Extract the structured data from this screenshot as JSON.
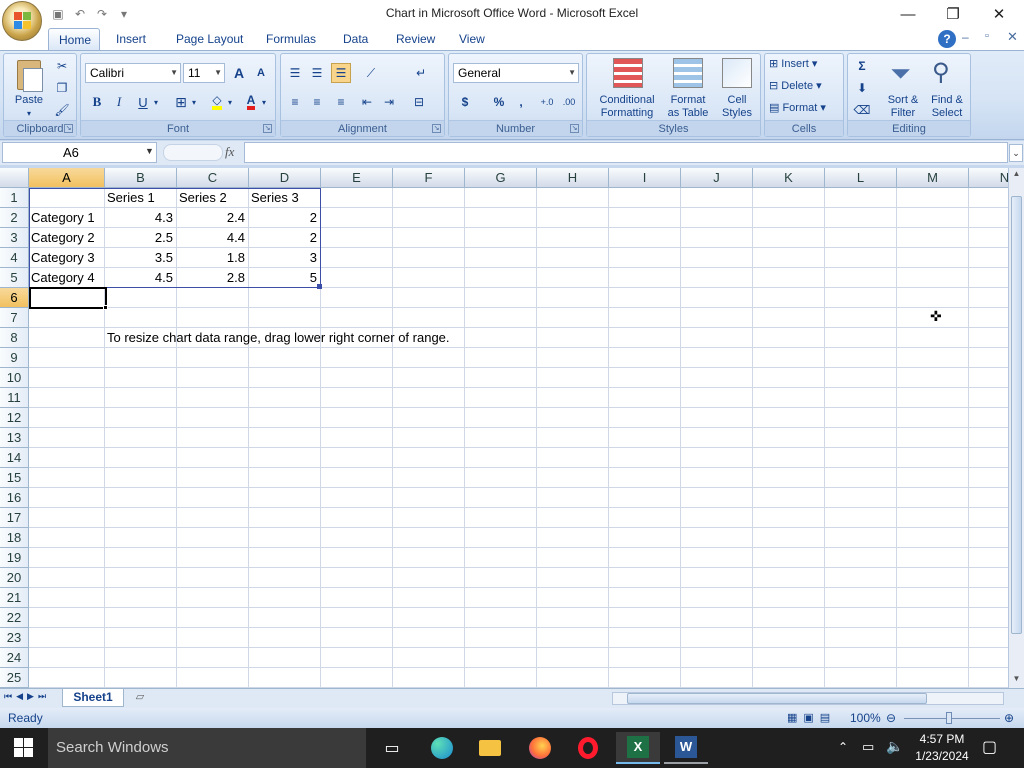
{
  "window": {
    "title": "Chart in Microsoft Office Word - Microsoft Excel",
    "minimize": "—",
    "restore": "❐",
    "close": "✕"
  },
  "tabs": [
    "Home",
    "Insert",
    "Page Layout",
    "Formulas",
    "Data",
    "Review",
    "View"
  ],
  "ribbon": {
    "clipboard": {
      "label": "Clipboard",
      "paste": "Paste"
    },
    "font": {
      "label": "Font",
      "name": "Calibri",
      "size": "11",
      "bold": "B",
      "italic": "I",
      "underline": "U",
      "grow": "A",
      "shrink": "A"
    },
    "alignment": {
      "label": "Alignment"
    },
    "number": {
      "label": "Number",
      "format": "General",
      "currency": "$",
      "percent": "%",
      "comma": ","
    },
    "styles": {
      "label": "Styles",
      "conditional_line1": "Conditional",
      "conditional_line2": "Formatting",
      "format_table_line1": "Format",
      "format_table_line2": "as Table",
      "cell_styles_line1": "Cell",
      "cell_styles_line2": "Styles"
    },
    "cells": {
      "label": "Cells",
      "insert": "Insert",
      "delete": "Delete",
      "format": "Format"
    },
    "editing": {
      "label": "Editing",
      "sum": "Σ",
      "sort_line1": "Sort &",
      "sort_line2": "Filter",
      "find_line1": "Find &",
      "find_line2": "Select"
    }
  },
  "formula_bar": {
    "name_box": "A6",
    "fx": "fx",
    "value": ""
  },
  "columns": [
    "A",
    "B",
    "C",
    "D",
    "E",
    "F",
    "G",
    "H",
    "I",
    "J",
    "K",
    "L",
    "M",
    "N"
  ],
  "rows": [
    "1",
    "2",
    "3",
    "4",
    "5",
    "6",
    "7",
    "8",
    "9",
    "10",
    "11",
    "12",
    "13",
    "14",
    "15",
    "16",
    "17",
    "18",
    "19",
    "20",
    "21",
    "22",
    "23",
    "24",
    "25"
  ],
  "sheet": {
    "header_row": [
      "",
      "Series 1",
      "Series 2",
      "Series 3"
    ],
    "data_rows": [
      [
        "Category 1",
        "4.3",
        "2.4",
        "2"
      ],
      [
        "Category 2",
        "2.5",
        "4.4",
        "2"
      ],
      [
        "Category 3",
        "3.5",
        "1.8",
        "3"
      ],
      [
        "Category 4",
        "4.5",
        "2.8",
        "5"
      ]
    ],
    "note": "To resize chart data range, drag lower right corner of range."
  },
  "sheet_tabs": {
    "active": "Sheet1"
  },
  "status": {
    "ready": "Ready",
    "zoom": "100%"
  },
  "taskbar": {
    "search_placeholder": "Search Windows",
    "time": "4:57 PM",
    "date": "1/23/2024"
  },
  "colors": {
    "accent": "#15428b",
    "ribbon": "#d6e4f5",
    "selection": "#f1c15f"
  }
}
